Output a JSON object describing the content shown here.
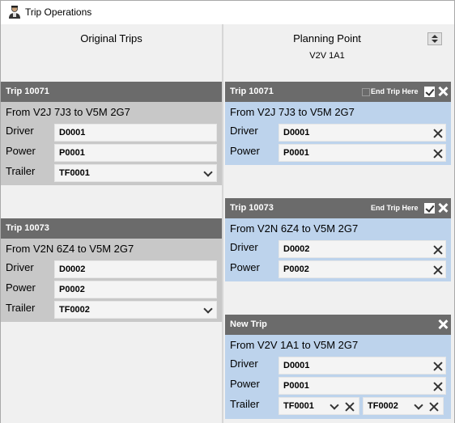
{
  "window": {
    "title": "Trip Operations",
    "icon": "user-icon"
  },
  "left": {
    "title": "Original Trips",
    "trips": [
      {
        "title": "Trip 10071",
        "route": "From V2J 7J3 to V5M 2G7",
        "driver_label": "Driver",
        "driver": "D0001",
        "power_label": "Power",
        "power": "P0001",
        "trailer_label": "Trailer",
        "trailer": "TF0001"
      },
      {
        "title": "Trip 10073",
        "route": "From V2N 6Z4 to V5M 2G7",
        "driver_label": "Driver",
        "driver": "D0002",
        "power_label": "Power",
        "power": "P0002",
        "trailer_label": "Trailer",
        "trailer": "TF0002"
      }
    ]
  },
  "right": {
    "title": "Planning Point",
    "subtitle": "V2V 1A1",
    "trips": [
      {
        "title": "Trip 10071",
        "end_trip_label": "End Trip Here",
        "end_trip_checked": false,
        "route": "From V2J 7J3 to V5M 2G7",
        "driver_label": "Driver",
        "driver": "D0001",
        "power_label": "Power",
        "power": "P0001"
      },
      {
        "title": "Trip 10073",
        "end_trip_label": "End Trip Here",
        "end_trip_checked": true,
        "route": "From V2N 6Z4 to V5M 2G7",
        "driver_label": "Driver",
        "driver": "D0002",
        "power_label": "Power",
        "power": "P0002"
      },
      {
        "title": "New Trip",
        "route": "From V2V 1A1 to V5M 2G7",
        "driver_label": "Driver",
        "driver": "D0001",
        "power_label": "Power",
        "power": "P0001",
        "trailer_label": "Trailer",
        "trailers": [
          "TF0001",
          "TF0002"
        ]
      }
    ]
  },
  "colors": {
    "header": "#6b6b6b",
    "grey_body": "#c8c8c8",
    "blue_body": "#bdd3ec",
    "pane": "#f0f0f0"
  }
}
